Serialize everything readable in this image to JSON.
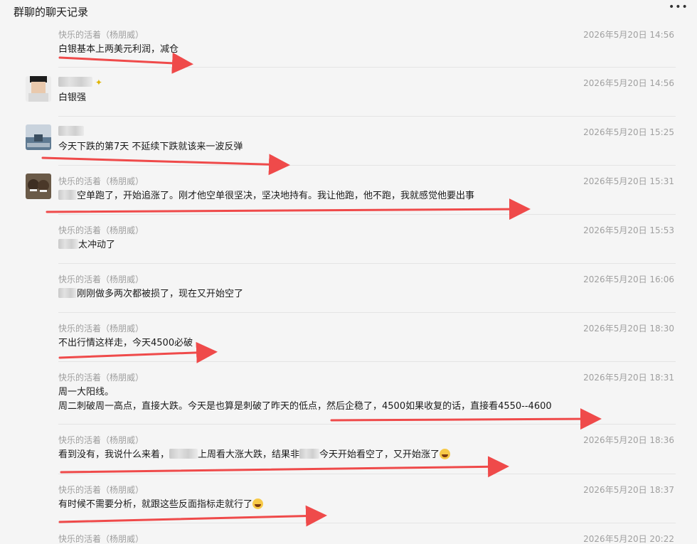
{
  "window": {
    "title": "群聊的聊天记录"
  },
  "colors": {
    "arrow": "#ef4a4a",
    "timestamp": "#a0a0a0",
    "sender": "#9e9e9e"
  },
  "messages": [
    {
      "sender": "快乐的活着（杨朋威）",
      "time": "2026年5月20日 14:56",
      "text": "白银基本上两美元利润，减仓"
    },
    {
      "sender": "",
      "time": "2026年5月20日 14:56",
      "text": "白银强"
    },
    {
      "sender": "",
      "time": "2026年5月20日 15:25",
      "text": "今天下跌的第7天    不延续下跌就该来一波反弹"
    },
    {
      "sender": "快乐的活着（杨朋威）",
      "time": "2026年5月20日 15:31",
      "text": "空单跑了，开始追涨了。刚才他空单很坚决，坚决地持有。我让他跑，他不跑，我就感觉他要出事"
    },
    {
      "sender": "快乐的活着（杨朋威）",
      "time": "2026年5月20日 15:53",
      "text": "太冲动了"
    },
    {
      "sender": "快乐的活着（杨朋威）",
      "time": "2026年5月20日 16:06",
      "text": "刚刚做多两次都被损了，现在又开始空了"
    },
    {
      "sender": "快乐的活着（杨朋威）",
      "time": "2026年5月20日 18:30",
      "text": "不出行情这样走，今天4500必破"
    },
    {
      "sender": "快乐的活着（杨朋威）",
      "time": "2026年5月20日 18:31",
      "text": "周一大阳线。",
      "text2": "周二刺破周一高点，直接大跌。今天是也算是刺破了昨天的低点，然后企稳了，4500如果收复的话，直接看4550--4600"
    },
    {
      "sender": "快乐的活着（杨朋威）",
      "time": "2026年5月20日 18:36",
      "text_a": "看到没有，我说什么来着，",
      "text_b": "上周看大涨大跌，结果非",
      "text_c": "今天开始看空了，又开始涨了"
    },
    {
      "sender": "快乐的活着（杨朋威）",
      "time": "2026年5月20日 18:37",
      "text": "有时候不需要分析，就跟这些反面指标走就行了"
    },
    {
      "sender": "快乐的活着（杨朋威）",
      "time": "2026年5月20日 20:22"
    }
  ]
}
